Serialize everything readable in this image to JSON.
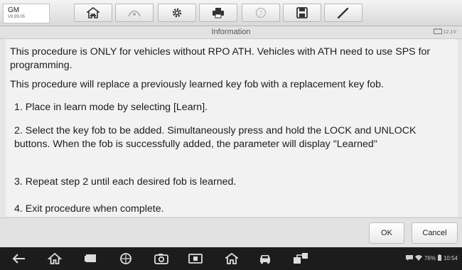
{
  "vehicle": {
    "make": "GM",
    "version": "V8.99.05"
  },
  "toolbar": {
    "tools": [
      "home-icon",
      "vci-icon",
      "settings-icon",
      "print-icon",
      "help-icon",
      "save-icon",
      "edit-icon"
    ]
  },
  "info": {
    "title": "Information",
    "battery_voltage": "12.1V"
  },
  "content": {
    "p1": "This procedure is ONLY for vehicles without RPO ATH. Vehicles with ATH need to use SPS for programming.",
    "p2": "This procedure will replace a previously learned key fob with a replacement key fob.",
    "step1": "1. Place in learn mode by selecting [Learn].",
    "step2": "2. Select the key fob to be added. Simultaneously press and hold the LOCK and UNLOCK buttons. When the fob is successfully added, the parameter will display \"Learned\"",
    "step3": "3. Repeat step 2 until each desired fob is learned.",
    "step4": "4. Exit procedure when complete."
  },
  "footer": {
    "ok_label": "OK",
    "cancel_label": "Cancel"
  },
  "navbar": {
    "icons": [
      "back-icon",
      "home-icon",
      "recents-icon",
      "browser-icon",
      "camera-icon",
      "screen-capture-icon",
      "maxi-home-icon",
      "car-icon",
      "vci-manager-icon"
    ]
  },
  "status": {
    "battery": "76%",
    "time": "10:54"
  }
}
